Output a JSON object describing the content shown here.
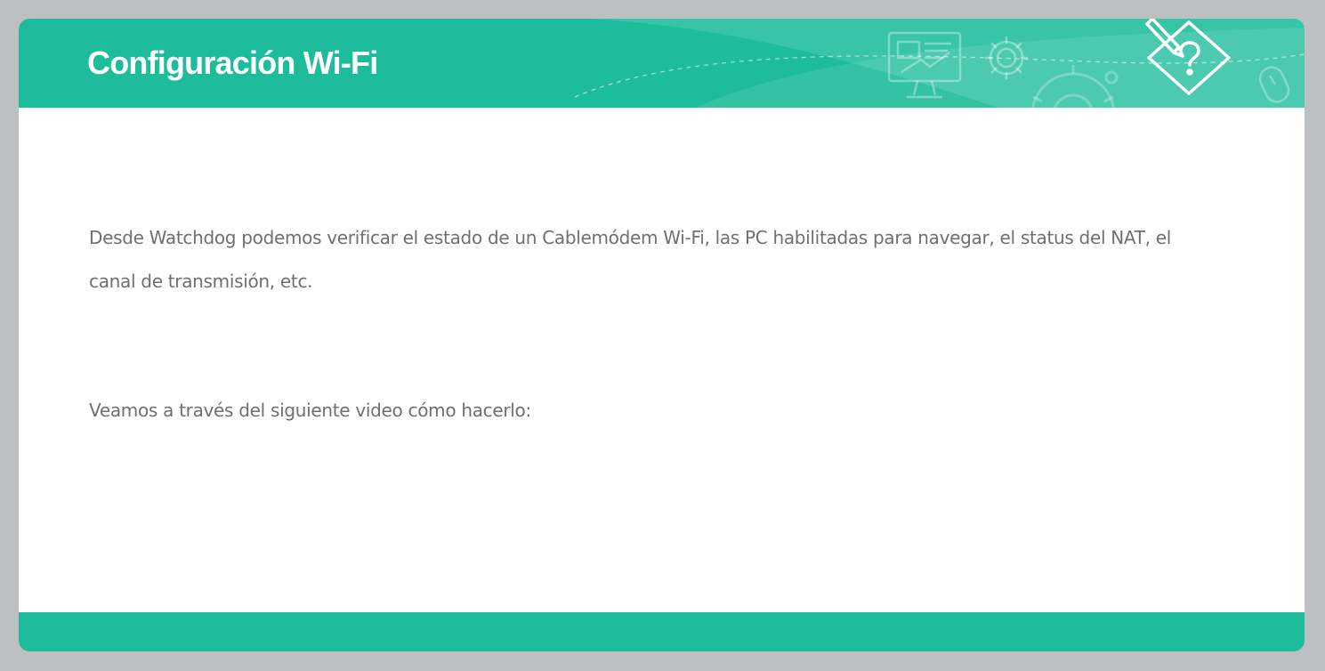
{
  "header": {
    "title": "Configuración Wi-Fi",
    "colors": {
      "accent": "#1dbc9a",
      "background": "#bcc0c3"
    },
    "icons": [
      "monitor-presentation-icon",
      "gear-icon",
      "large-gear-icon",
      "pencil-question-icon",
      "mouse-icon"
    ]
  },
  "content": {
    "paragraph1": "Desde Watchdog podemos verificar el estado de un Cablemódem Wi-Fi, las PC habilitadas para navegar, el status del NAT, el canal de transmisión, etc.",
    "paragraph2": "Veamos a través del siguiente video cómo hacerlo:"
  }
}
